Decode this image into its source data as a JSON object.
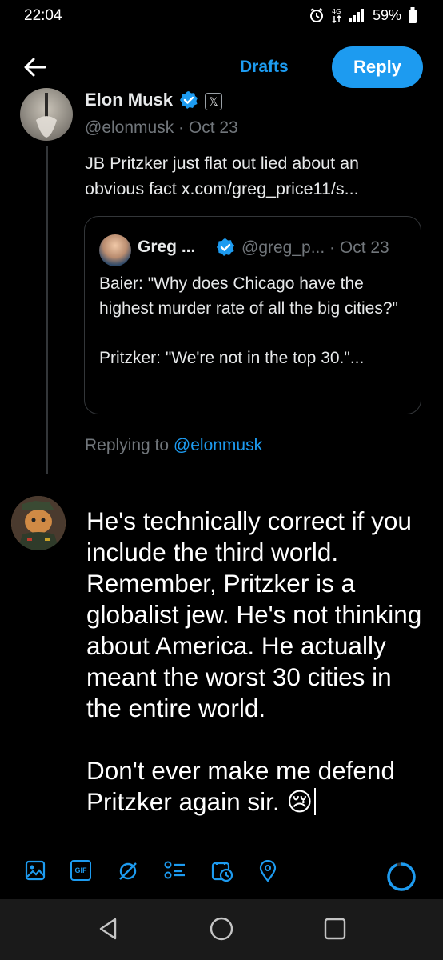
{
  "status": {
    "time": "22:04",
    "battery": "59%"
  },
  "topbar": {
    "drafts": "Drafts",
    "reply": "Reply"
  },
  "tweet": {
    "author": "Elon Musk",
    "handle_date": "@elonmusk · Oct 23",
    "text": "JB Pritzker just flat out lied about an obvious fact x.com/greg_price11/s..."
  },
  "quote": {
    "author": "Greg ...",
    "handle_date": "@greg_p... · Oct 23",
    "line1": "Baier: \"Why does Chicago have the highest murder rate of all the big cities?\"",
    "line2": "Pritzker: \"We're not in the top 30.\"..."
  },
  "replying": {
    "prefix": "Replying to",
    "mention": "@elonmusk"
  },
  "compose": {
    "para1": "He's technically correct if you include the third world. Remember, Pritzker is a globalist jew. He's not thinking about America. He actually meant the worst 30 cities in the entire world.",
    "para2": "Don't ever make me defend Pritzker again sir. 😢"
  },
  "toolbar": {
    "icons": [
      "image-icon",
      "gif-icon",
      "grok-icon",
      "poll-icon",
      "schedule-icon",
      "location-icon"
    ],
    "gif": "GIF"
  },
  "colors": {
    "accent": "#1d9bf0",
    "background": "#000000",
    "muted": "#71767b"
  }
}
